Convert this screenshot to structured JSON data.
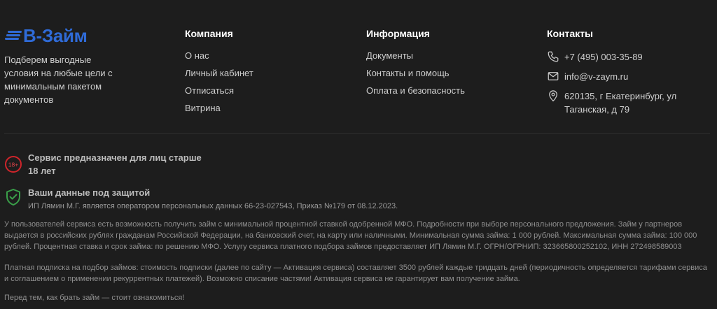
{
  "brand": {
    "name": "В-Займ",
    "tagline": "Подберем выгодные условия на любые цели с минимальным пакетом документов",
    "accent_color": "#2f6bd8"
  },
  "company": {
    "heading": "Компания",
    "links": [
      "О нас",
      "Личный кабинет",
      "Отписаться",
      "Витрина"
    ]
  },
  "info": {
    "heading": "Информация",
    "links": [
      "Документы",
      "Контакты и помощь",
      "Оплата и безопасность"
    ]
  },
  "contacts": {
    "heading": "Контакты",
    "phone": "+7 (495) 003-35-89",
    "email": "info@v-zaym.ru",
    "address": "620135, г Екатеринбург, ул Таганская, д 79"
  },
  "notices": {
    "age": {
      "badge": "18+",
      "title": "Сервис предназначен для лиц старше 18 лет",
      "badge_color": "#d0252b"
    },
    "data": {
      "title": "Ваши данные под защитой",
      "text": "ИП Лямин М.Г. является оператором персональных данных 66-23-027543, Приказ №179 от 08.12.2023.",
      "badge_color": "#3aa04a"
    }
  },
  "legal": {
    "p1": "У пользователей сервиса есть возможность получить займ с минимальной процентной ставкой одобренной МФО. Подробности при выборе персонального предложения. Займ у партнеров выдается в российских рублях гражданам Российской Федерации, на банковский счет, на карту или наличными. Минимальная сумма займа: 1 000 рублей. Максимальная сумма займа: 100 000 рублей. Процентная ставка и срок займа: по решению МФО. Услугу сервиса платного подбора займов предоставляет ИП Лямин М.Г. ОГРН/ОГРНИП: 323665800252102, ИНН 272498589003",
    "p2": "Платная подписка на подбор займов: стоимость подписки (далее по сайту — Активация сервиса) составляет 3500 рублей каждые тридцать дней (периодичность определяется тарифами сервиса и соглашением о применении рекуррентных платежей). Возможно списание частями! Активация сервиса не гарантирует вам получение займа.",
    "p3": "Перед тем, как брать займ — стоит ознакомиться!"
  },
  "icons": {
    "phone": "phone-icon",
    "email": "mail-icon",
    "address": "map-pin-icon",
    "age": "age-18-icon",
    "data": "shield-check-icon"
  }
}
